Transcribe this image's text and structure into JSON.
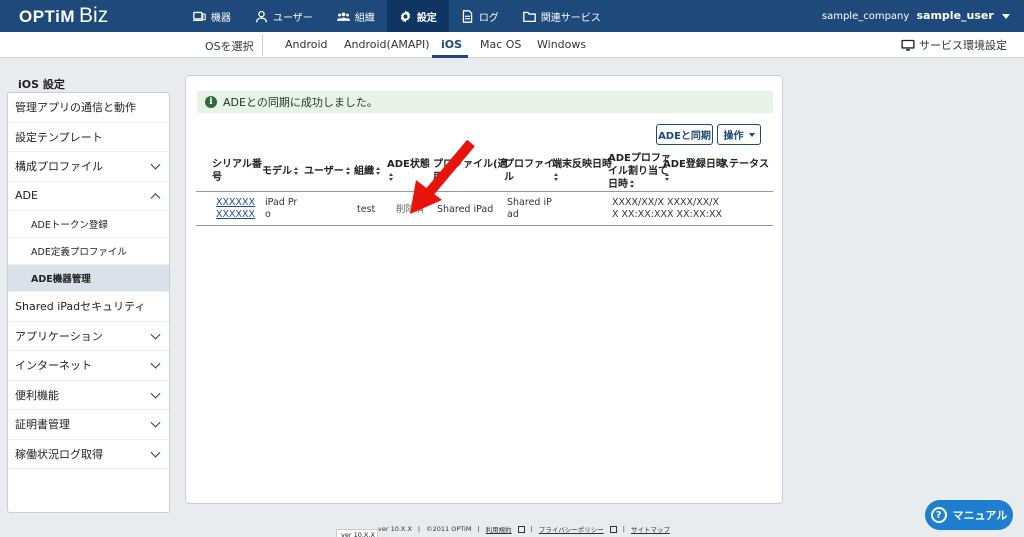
{
  "header": {
    "logo_brand": "OPTiM",
    "logo_product": "Biz",
    "nav": [
      {
        "label": "機器",
        "icon": "device-icon"
      },
      {
        "label": "ユーザー",
        "icon": "user-icon"
      },
      {
        "label": "組織",
        "icon": "group-icon"
      },
      {
        "label": "設定",
        "icon": "gear-icon",
        "active": true
      },
      {
        "label": "ログ",
        "icon": "log-icon"
      },
      {
        "label": "関連サービス",
        "icon": "folder-icon"
      }
    ],
    "company": "sample_company",
    "username": "sample_user"
  },
  "subnav": {
    "os_label": "OSを選択",
    "tabs": [
      {
        "label": "Android"
      },
      {
        "label": "Android(AMAPI)"
      },
      {
        "label": "iOS",
        "active": true
      },
      {
        "label": "Mac OS"
      },
      {
        "label": "Windows"
      }
    ],
    "service_env": "サービス環境設定"
  },
  "sidebar": {
    "title": "iOS 設定",
    "items": [
      {
        "label": "管理アプリの通信と動作"
      },
      {
        "label": "設定テンプレート"
      },
      {
        "label": "構成プロファイル",
        "chevron": "down"
      },
      {
        "label": "ADE",
        "chevron": "up"
      },
      {
        "label": "ADEトークン登録",
        "sub": true
      },
      {
        "label": "ADE定義プロファイル",
        "sub": true
      },
      {
        "label": "ADE機器管理",
        "sub": true,
        "active": true
      },
      {
        "label": "Shared iPadセキュリティ"
      },
      {
        "label": "アプリケーション",
        "chevron": "down"
      },
      {
        "label": "インターネット",
        "chevron": "down"
      },
      {
        "label": "便利機能",
        "chevron": "down"
      },
      {
        "label": "証明書管理",
        "chevron": "down"
      },
      {
        "label": "稼働状況ログ取得",
        "chevron": "down"
      }
    ]
  },
  "main": {
    "alert": "ADEとの同期に成功しました。",
    "sync_button": "ADEと同期",
    "action_button": "操作",
    "table": {
      "headers": {
        "serial_1": "シリアル番",
        "serial_2": "号",
        "model": "モデル",
        "user": "ユーザー",
        "org": "組織",
        "ade_state": "ADE状態",
        "profile_apply_1": "プロファイル(適",
        "profile_apply_2": "用)",
        "profile_1": "プロファイ",
        "profile_2": "ル",
        "device_reflect": "端末反映日時",
        "ade_profile_assign_1": "ADEプロファ",
        "ade_profile_assign_2": "イル割り当て",
        "ade_profile_assign_3": "日時",
        "ade_registered": "ADE登録日時",
        "status": "ステータス"
      },
      "row": {
        "serial_1": "XXXXXX",
        "serial_2": "XXXXXX",
        "model_1": "iPad Pr",
        "model_2": "o",
        "org": "test",
        "ade_state": "削除済",
        "profile_apply": "Shared iPad",
        "profile_1": "Shared iP",
        "profile_2": "ad",
        "assign_1": "XXXX/XX/X",
        "assign_2": "X XX:XX:XX",
        "registered_1": "XXXX/XX/X",
        "registered_2": "X XX:XX:XX"
      }
    }
  },
  "footer": {
    "version_tab": "ver 10.X.X",
    "version": "ver 10.X.X",
    "copyright": "©2011 OPTiM",
    "terms": "利用規約",
    "privacy": "プライバシーポリシー",
    "sitemap": "サイトマップ"
  },
  "manual_button": "マニュアル",
  "colors": {
    "header_bg": "#1d4a7a",
    "accent": "#1d4a7a",
    "alert_bg": "#e8f3e8",
    "annotation_arrow": "#e8140c",
    "manual_button": "#1e7fd0"
  }
}
